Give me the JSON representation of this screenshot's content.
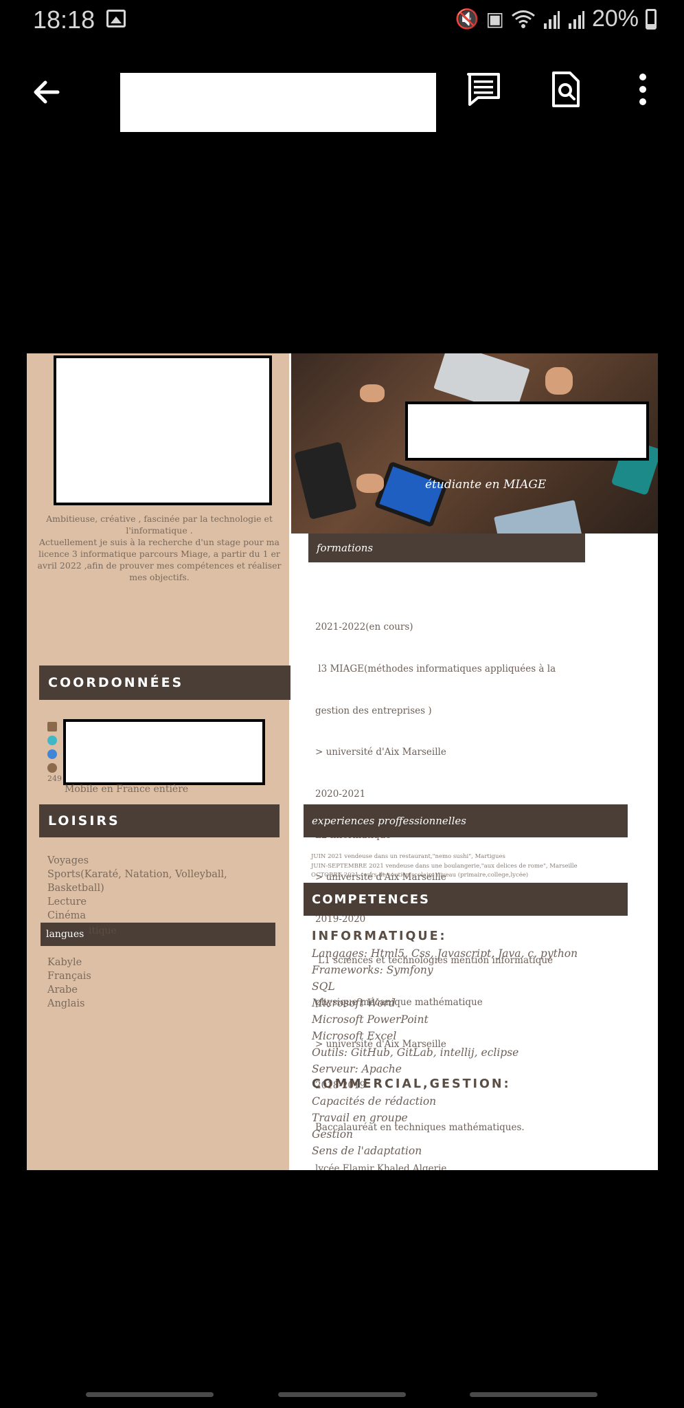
{
  "status": {
    "time": "18:18",
    "battery": "20%"
  },
  "toolbar": {
    "back": "back-arrow-icon",
    "comment": "comment-icon",
    "find": "search-document-icon",
    "more": "more-vert-icon"
  },
  "resume": {
    "intro": "Ambitieuse, créative ,  fascinée  par la technologie et l'informatique .\nActuellement je suis à la recherche d'un stage pour ma licence 3 informatique parcours Miage, a partir du 1 er avril 2022 ,afin de prouver mes compétences  et  réaliser mes objectifs.",
    "coordonnees_title": "COORDONNÉES",
    "contact_number": "249",
    "mobile": "Mobile en France entière",
    "loisirs_title": "LOISIRS",
    "loisirs": [
      "Voyages",
      "Sports(Karaté, Natation, Volleyball,",
      "Basketball)",
      "Lecture",
      "Cinéma"
    ],
    "langues_title": "langues",
    "langues_ghost": "itique",
    "langues": [
      "Kabyle",
      "Français",
      "Arabe",
      "Anglais"
    ],
    "subtitle": "étudiante en MIAGE",
    "formations_title": "formations",
    "formations": [
      "2021-2022(en cours)",
      " l3 MIAGE(méthodes informatiques appliquées à la",
      "gestion des entreprises )",
      "> université d'Aix Marseille",
      "2020-2021",
      "L2 informatique",
      "> université d'Aix Marseille",
      "2019-2020",
      " L1 sciences et technologies mention informatique",
      "physique mécanique mathématique",
      "> université d'Aix Marseille",
      "2018-2019",
      "Baccalauréat en techniques mathématiques.",
      "lycée Elamir Khaled,Algerie"
    ],
    "experiences_title": "experiences proffessionnelles",
    "experiences": [
      "JUIN  2021 vendeuse dans un restaurant,\"nemo sushi\", Martigues",
      "JUIN-SEPTEMBRE 2021 vendeuse dans une boulangerie,\"aux delices de rome\", Marseille",
      "OCTOBRE 2021 cours de soutien scolaire niveau (primaire,college,lycée)"
    ],
    "competences_title": "COMPETENCES",
    "informatique_title": "INFORMATIQUE:",
    "informatique": [
      "Langages: Html5, Css, Javascript, Java, c, python",
      "Frameworks: Symfony",
      "SQL",
      "Microsoft Word",
      "Microsoft PowerPoint",
      "Microsoft Excel",
      "Outils: GitHub, GitLab, intellij, eclipse",
      "Serveur: Apache"
    ],
    "commercial_title": "COMMERCIAL,GESTION:",
    "commercial": [
      "Capacités de rédaction",
      "Travail en groupe",
      " Gestion",
      "Sens de l'adaptation"
    ]
  }
}
